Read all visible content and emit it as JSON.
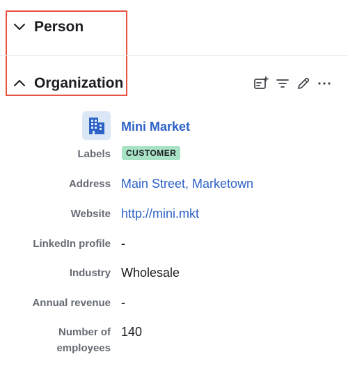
{
  "sections": {
    "person": {
      "title": "Person",
      "expanded": false
    },
    "organization": {
      "title": "Organization",
      "expanded": true
    }
  },
  "toolbar": {
    "icons": [
      "add-card-icon",
      "filter-icon",
      "edit-pencil-icon",
      "more-options-icon"
    ]
  },
  "organization": {
    "logo_icon": "building-icon",
    "name": "Mini Market",
    "fields": {
      "labels": {
        "label": "Labels",
        "value": "CUSTOMER",
        "color": "#a9e3c6"
      },
      "address": {
        "label": "Address",
        "value": "Main Street, Marketown"
      },
      "website": {
        "label": "Website",
        "value": "http://mini.mkt"
      },
      "linkedin": {
        "label": "LinkedIn profile",
        "value": "-"
      },
      "industry": {
        "label": "Industry",
        "value": "Wholesale"
      },
      "annual_revenue": {
        "label": "Annual revenue",
        "value": "-"
      },
      "employees": {
        "label_line1": "Number of",
        "label_line2": "employees",
        "value": "140"
      }
    }
  },
  "colors": {
    "link": "#2d63c6",
    "highlight": "#e8533f",
    "label": "#656a73"
  }
}
